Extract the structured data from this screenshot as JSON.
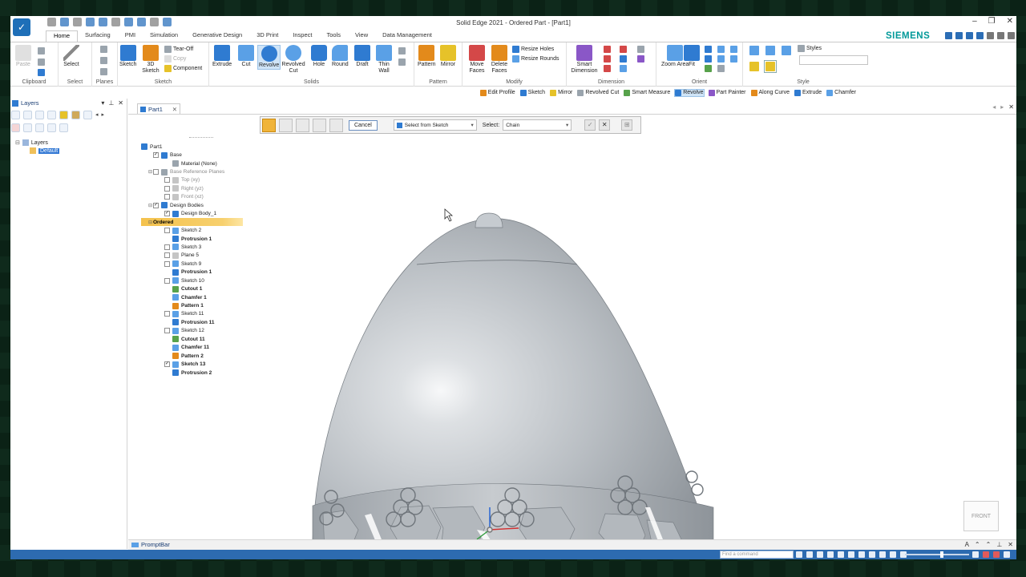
{
  "titlebar": {
    "title": "Solid Edge 2021 - Ordered Part - [Part1]"
  },
  "brand": "SIEMENS",
  "menu": {
    "tabs": [
      {
        "label": "Home",
        "active": true
      },
      {
        "label": "Surfacing"
      },
      {
        "label": "PMI"
      },
      {
        "label": "Simulation"
      },
      {
        "label": "Generative Design"
      },
      {
        "label": "3D Print"
      },
      {
        "label": "Inspect"
      },
      {
        "label": "Tools"
      },
      {
        "label": "View"
      },
      {
        "label": "Data Management"
      }
    ]
  },
  "ribbon": {
    "clipboard": {
      "label": "Clipboard",
      "paste": "Paste"
    },
    "select": {
      "label": "Select",
      "select": "Select"
    },
    "planes": {
      "label": "Planes"
    },
    "sketch": {
      "label": "Sketch",
      "sketch": "Sketch",
      "sketch3d": "3D Sketch",
      "tearoff": "Tear-Off",
      "copy": "Copy",
      "component": "Component"
    },
    "solids": {
      "label": "Solids",
      "extrude": "Extrude",
      "cut": "Cut",
      "revolve": "Revolve",
      "revolved_cut": "Revolved Cut",
      "hole": "Hole",
      "round": "Round",
      "draft": "Draft",
      "thin_wall": "Thin Wall"
    },
    "pattern": {
      "label": "Pattern",
      "pattern": "Pattern",
      "mirror": "Mirror"
    },
    "modify": {
      "label": "Modify",
      "move_faces": "Move Faces",
      "delete_faces": "Delete Faces",
      "resize_holes": "Resize Holes",
      "resize_rounds": "Resize Rounds"
    },
    "dimension": {
      "label": "Dimension",
      "smart_dimension": "Smart Dimension"
    },
    "orient": {
      "label": "Orient",
      "zoom_area": "Zoom Area",
      "fit": "Fit"
    },
    "style": {
      "label": "Style",
      "styles": "Styles"
    }
  },
  "cmdbar": {
    "items": [
      {
        "label": "Edit Profile",
        "color": "#e38a1b"
      },
      {
        "label": "Sketch",
        "color": "#2f7bd1"
      },
      {
        "label": "Mirror",
        "color": "#e6c229"
      },
      {
        "label": "Revolved Cut",
        "color": "#9aa4ad"
      },
      {
        "label": "Smart Measure",
        "color": "#57a24b"
      },
      {
        "label": "Revolve",
        "color": "#2f7bd1",
        "active": true
      },
      {
        "label": "Part Painter",
        "color": "#8a57c7"
      },
      {
        "label": "Along Curve",
        "color": "#e38a1b"
      },
      {
        "label": "Extrude",
        "color": "#2f7bd1"
      },
      {
        "label": "Chamfer",
        "color": "#5aa0e6"
      }
    ]
  },
  "layers_panel": {
    "title": "Layers",
    "tree_root": "Layers",
    "tree_child": "Default"
  },
  "doc_tab": {
    "label": "Part1"
  },
  "command_toolbar": {
    "cancel": "Cancel",
    "select_from": "Select from Sketch",
    "select_label": "Select:",
    "select_value": "Chain"
  },
  "pathfinder": {
    "nodes": [
      {
        "text": "Part1",
        "level": 0,
        "exp": "⊟",
        "check": null,
        "icon": "#2f7bd1"
      },
      {
        "text": "Base",
        "level": 1,
        "exp": "",
        "check": "✓",
        "icon": "#2f7bd1"
      },
      {
        "text": "Material (None)",
        "level": 2,
        "exp": "",
        "check": null,
        "icon": "#9aa4ad"
      },
      {
        "text": "Base Reference Planes",
        "level": 1,
        "exp": "⊟",
        "check": "",
        "icon": "#9aa4ad",
        "dim": true
      },
      {
        "text": "Top (xy)",
        "level": 2,
        "exp": "",
        "check": "",
        "icon": "#c5c5c5",
        "dim": true
      },
      {
        "text": "Right (yz)",
        "level": 2,
        "exp": "",
        "check": "",
        "icon": "#c5c5c5",
        "dim": true
      },
      {
        "text": "Front (xz)",
        "level": 2,
        "exp": "",
        "check": "",
        "icon": "#c5c5c5",
        "dim": true
      },
      {
        "text": "Design Bodies",
        "level": 1,
        "exp": "⊟",
        "check": "✓",
        "icon": "#2f7bd1"
      },
      {
        "text": "Design Body_1",
        "level": 2,
        "exp": "",
        "check": "✓",
        "icon": "#2f7bd1"
      },
      {
        "text": "Ordered",
        "level": 1,
        "exp": "⊟",
        "check": null,
        "icon": null,
        "hl": true
      },
      {
        "text": "Sketch 2",
        "level": 2,
        "exp": "",
        "check": "",
        "icon": "#5aa0e6"
      },
      {
        "text": "Protrusion 1",
        "level": 2,
        "exp": "",
        "check": null,
        "icon": "#2f7bd1",
        "bold": true
      },
      {
        "text": "Sketch 3",
        "level": 2,
        "exp": "",
        "check": "",
        "icon": "#5aa0e6"
      },
      {
        "text": "Plane 5",
        "level": 2,
        "exp": "",
        "check": "",
        "icon": "#c5c5c5"
      },
      {
        "text": "Sketch 9",
        "level": 2,
        "exp": "",
        "check": "",
        "icon": "#5aa0e6"
      },
      {
        "text": "Protrusion 1",
        "level": 2,
        "exp": "",
        "check": null,
        "icon": "#2f7bd1",
        "bold": true
      },
      {
        "text": "Sketch 10",
        "level": 2,
        "exp": "",
        "check": "",
        "icon": "#5aa0e6"
      },
      {
        "text": "Cutout 1",
        "level": 2,
        "exp": "",
        "check": null,
        "icon": "#57a24b",
        "bold": true
      },
      {
        "text": "Chamfer 1",
        "level": 2,
        "exp": "",
        "check": null,
        "icon": "#5aa0e6",
        "bold": true
      },
      {
        "text": "Pattern 1",
        "level": 2,
        "exp": "",
        "check": null,
        "icon": "#e38a1b",
        "bold": true
      },
      {
        "text": "Sketch 11",
        "level": 2,
        "exp": "",
        "check": "",
        "icon": "#5aa0e6"
      },
      {
        "text": "Protrusion 11",
        "level": 2,
        "exp": "",
        "check": null,
        "icon": "#2f7bd1",
        "bold": true
      },
      {
        "text": "Sketch 12",
        "level": 2,
        "exp": "",
        "check": "",
        "icon": "#5aa0e6"
      },
      {
        "text": "Cutout 11",
        "level": 2,
        "exp": "",
        "check": null,
        "icon": "#57a24b",
        "bold": true
      },
      {
        "text": "Chamfer 11",
        "level": 2,
        "exp": "",
        "check": null,
        "icon": "#5aa0e6",
        "bold": true
      },
      {
        "text": "Pattern 2",
        "level": 2,
        "exp": "",
        "check": null,
        "icon": "#e38a1b",
        "bold": true
      },
      {
        "text": "Sketch 13",
        "level": 2,
        "exp": "",
        "check": "✓",
        "icon": "#5aa0e6",
        "bold": true
      },
      {
        "text": "Protrusion 2",
        "level": 2,
        "exp": "",
        "check": null,
        "icon": "#2f7bd1",
        "bold": true
      }
    ]
  },
  "viewcube": {
    "label": "FRONT"
  },
  "promptbar": {
    "label": "PromptBar"
  },
  "statusbar": {
    "find_placeholder": "Find a command"
  },
  "colors": {
    "accent": "#2d6bb0",
    "brand": "#009999",
    "highlight": "#f4c24d"
  }
}
